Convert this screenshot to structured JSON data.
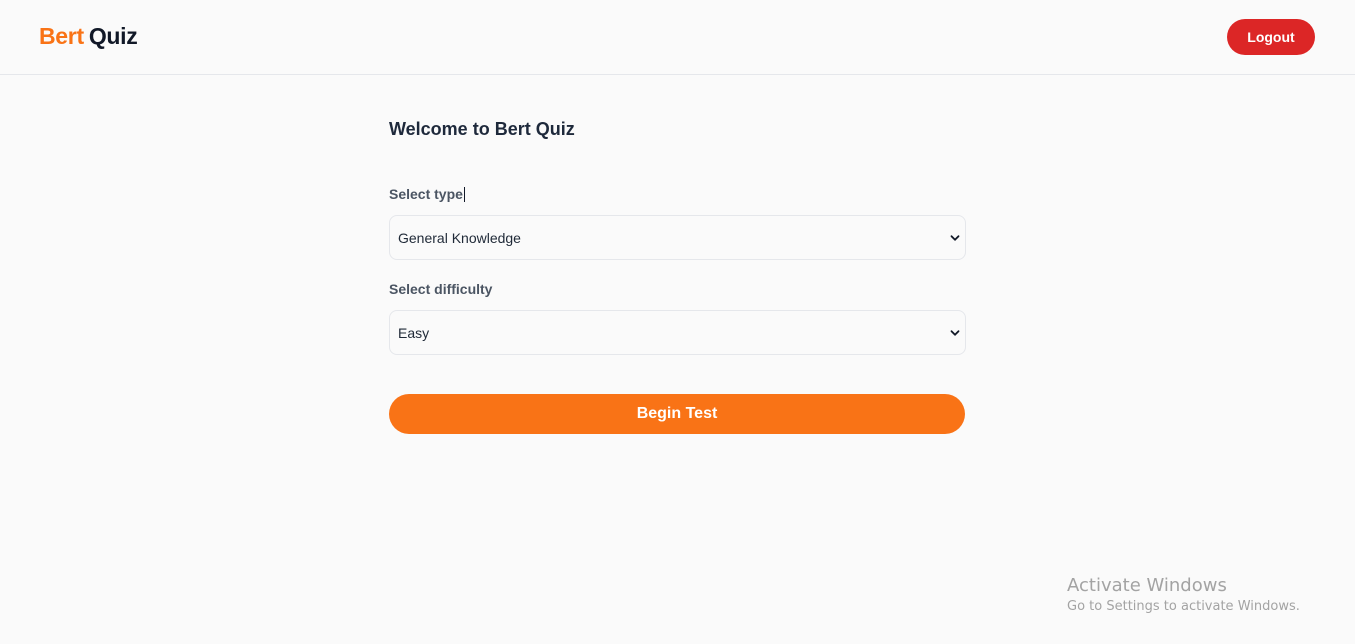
{
  "header": {
    "logo_part1": "Bert",
    "logo_part2": "Quiz",
    "logout_label": "Logout"
  },
  "main": {
    "welcome": "Welcome to Bert Quiz",
    "type_label": "Select type",
    "type_value": "General Knowledge",
    "difficulty_label": "Select difficulty",
    "difficulty_value": "Easy",
    "begin_label": "Begin Test"
  },
  "watermark": {
    "title": "Activate Windows",
    "subtitle": "Go to Settings to activate Windows."
  },
  "icons": {
    "type_select": "chevron-down-icon",
    "difficulty_select": "chevron-down-icon"
  },
  "colors": {
    "brand_orange": "#f97316",
    "logout_red": "#dc2626",
    "background": "#fafafa"
  }
}
